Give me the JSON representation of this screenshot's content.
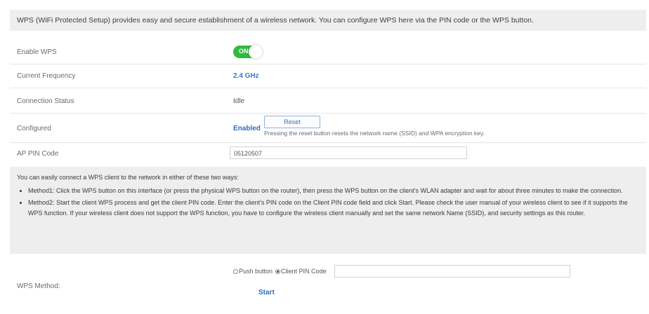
{
  "intro": "WPS (WiFi Protected Setup) provides easy and secure establishment of a wireless network. You can configure WPS here via the PIN code or the WPS button.",
  "enable_wps": {
    "label": "Enable WPS",
    "toggle_text": "ON",
    "state": true
  },
  "current_frequency": {
    "label": "Current Frequency",
    "value": "2.4 GHz"
  },
  "connection_status": {
    "label": "Connection Status",
    "value": "Idle"
  },
  "configured": {
    "label": "Configured",
    "value": "Enabled",
    "reset_label": "Reset",
    "reset_note": "Pressing the reset button resets the network name (SSID) and WPA encryption key."
  },
  "ap_pin": {
    "label": "AP PIN Code",
    "value": "05120507"
  },
  "howto": {
    "intro": "You can easily connect a WPS client to the network in either of these two ways:",
    "method1": "Method1: Click the WPS button on this interface (or press the physical WPS button on the router), then press the WPS button on the client's WLAN adapter and wait for about three minutes to make the connection.",
    "method2": "Method2: Start the client WPS process and get the client PIN code. Enter the client's PIN code on the Client PIN code field and click Start. Please check the user manual of your wireless client to see if it supports the WPS function. If your wireless client does not support the WPS function, you have to configure the wireless client manually and set the same network Name (SSID), and security settings as this router."
  },
  "wps_method": {
    "label": "WPS Method:",
    "options": [
      "Push button",
      "Client PIN Code"
    ],
    "selected": "Client PIN Code",
    "client_pin_value": "",
    "start_label": "Start"
  },
  "colors": {
    "toggle_on": "#2fba3e",
    "link_blue": "#2f6db8",
    "panel_bg": "#eeeeee"
  }
}
